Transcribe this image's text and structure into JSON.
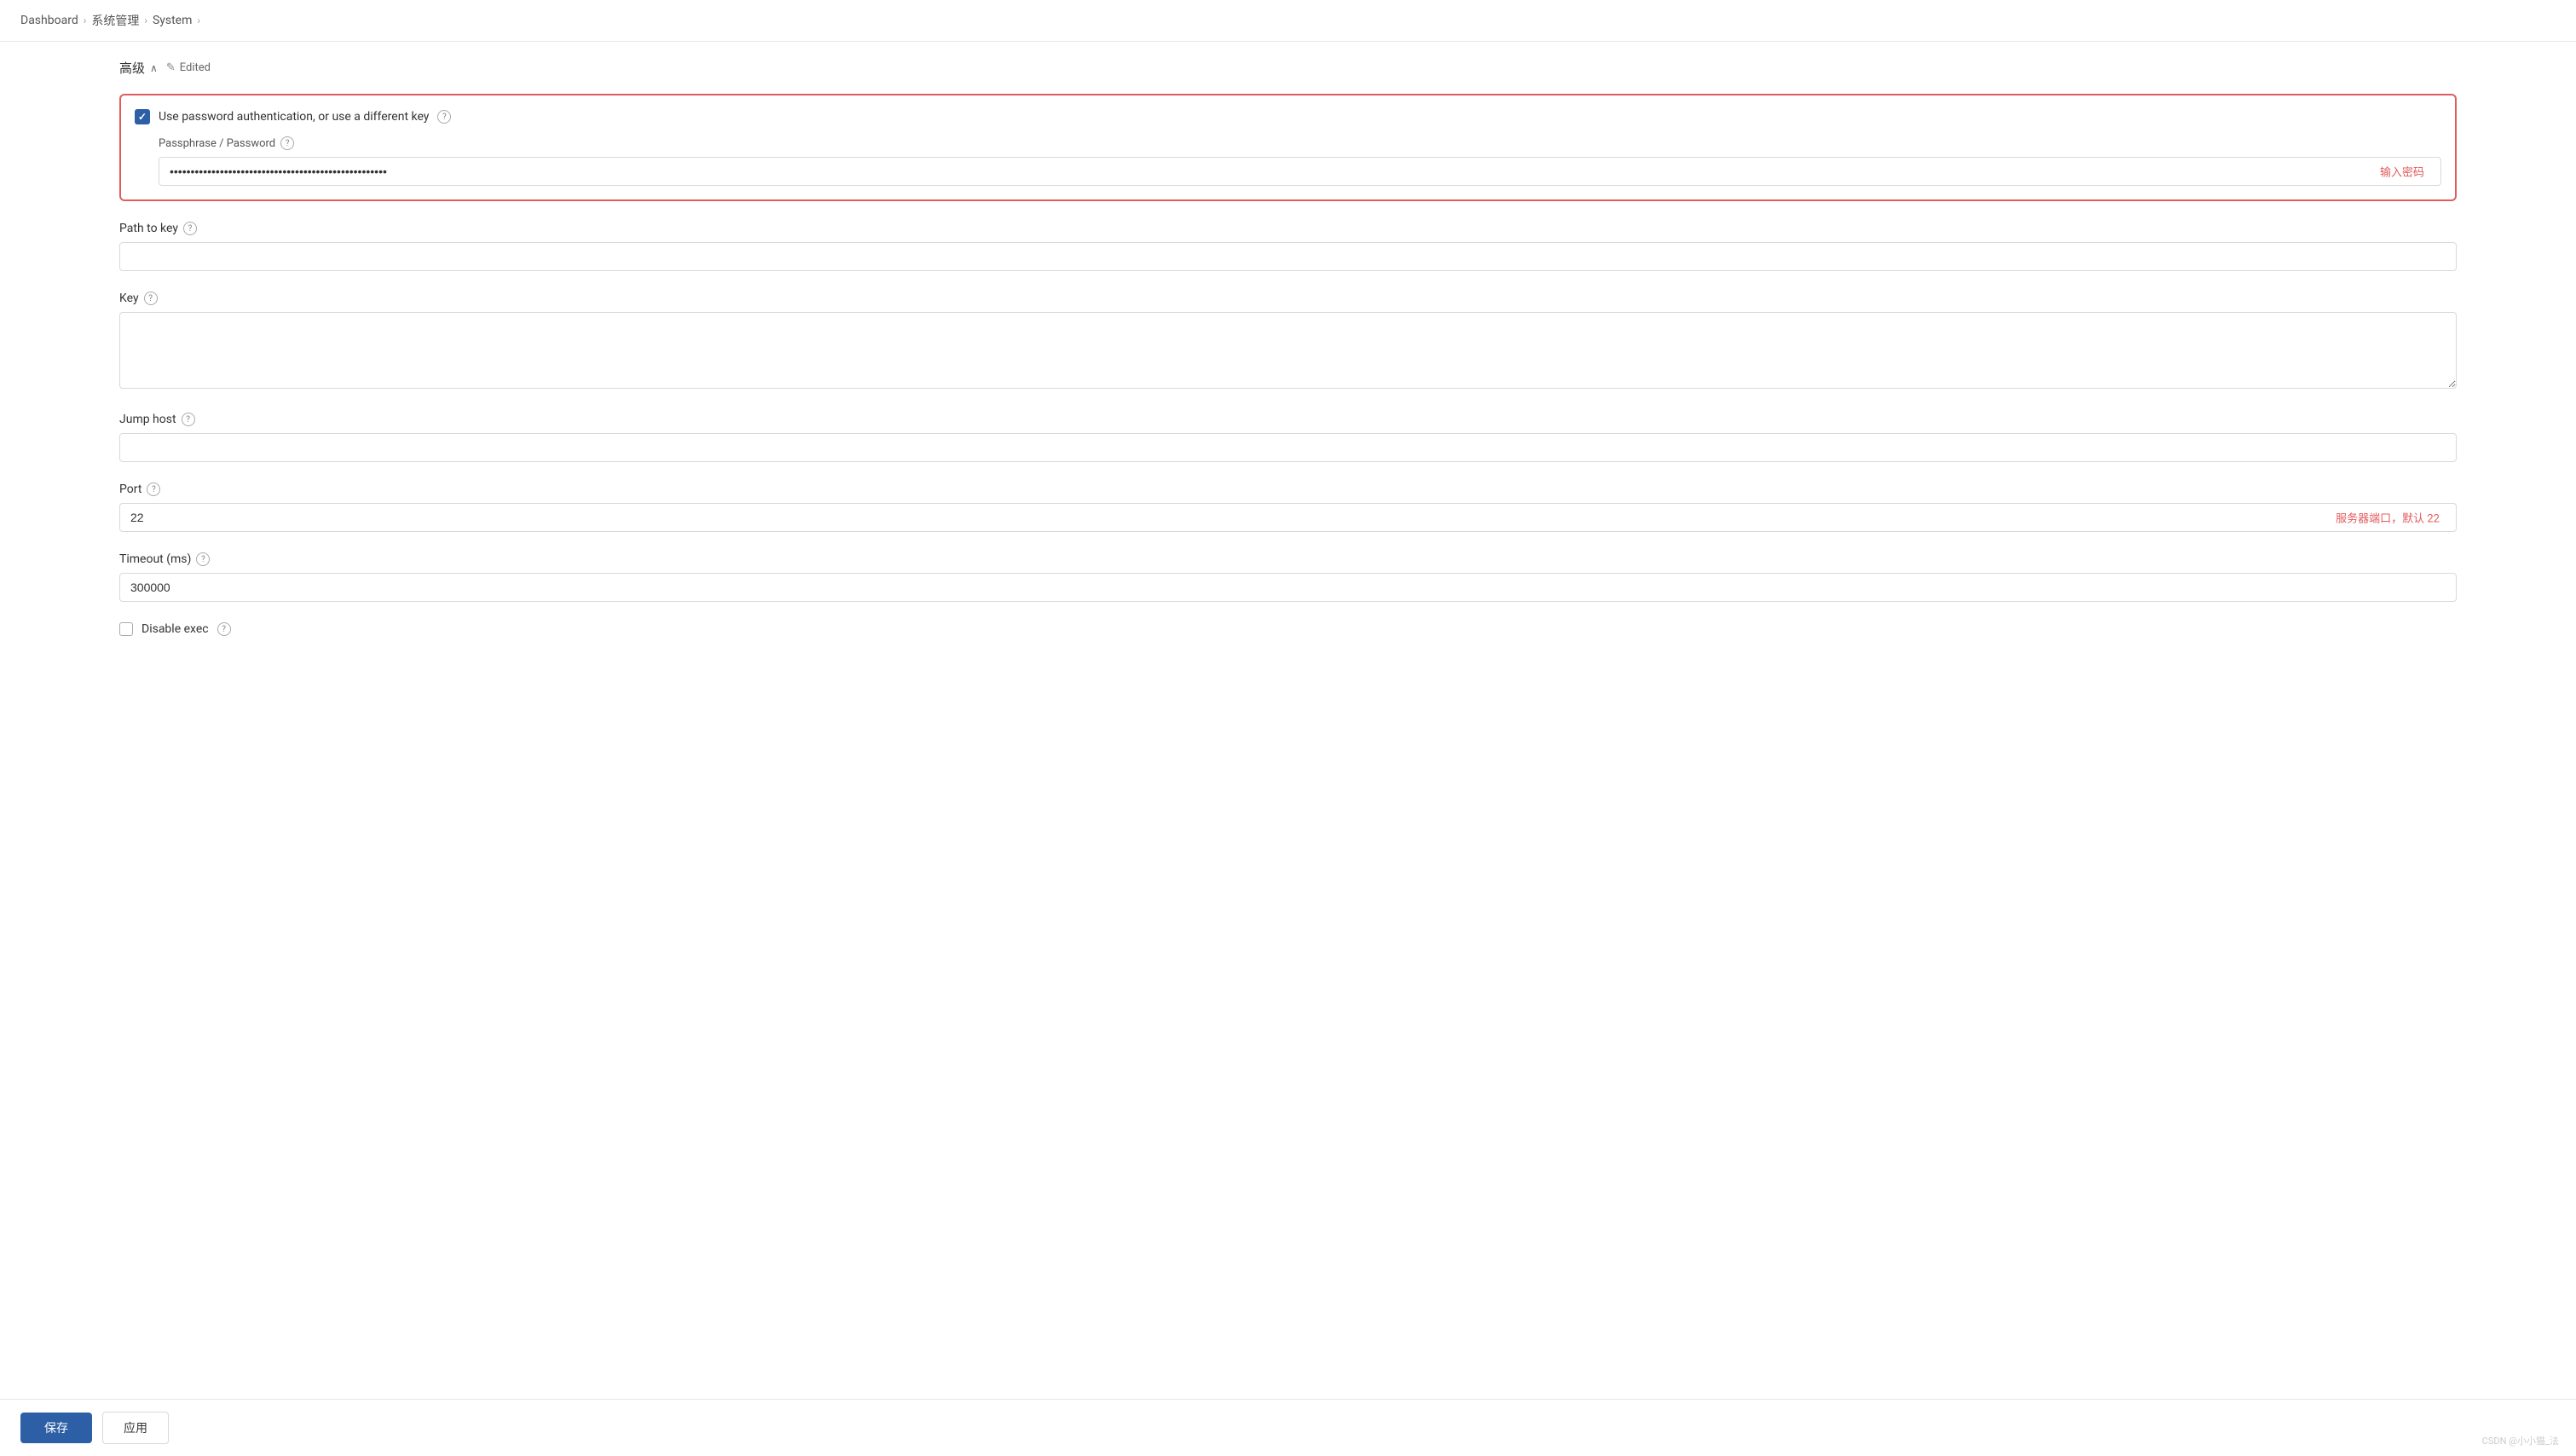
{
  "breadcrumb": {
    "items": [
      "Dashboard",
      "系统管理",
      "System"
    ],
    "separators": [
      "›",
      "›",
      "›"
    ]
  },
  "section": {
    "title": "高级",
    "chevron": "∧",
    "edited_icon": "✎",
    "edited_label": "Edited"
  },
  "password_auth": {
    "checkbox_label": "Use password authentication, or use a different key",
    "passphrase_label": "Passphrase / Password",
    "password_placeholder": "••••••••••••••••••••••••••••••••••••••••••••••••••••",
    "password_hint": "输入密码"
  },
  "fields": {
    "path_to_key": {
      "label": "Path to key",
      "value": "",
      "placeholder": ""
    },
    "key": {
      "label": "Key",
      "value": "",
      "placeholder": ""
    },
    "jump_host": {
      "label": "Jump host",
      "value": "",
      "placeholder": ""
    },
    "port": {
      "label": "Port",
      "value": "22",
      "hint": "服务器端口，默认 22"
    },
    "timeout": {
      "label": "Timeout (ms)",
      "value": "300000"
    },
    "disable_exec": {
      "label": "Disable exec"
    }
  },
  "help_icon_label": "?",
  "buttons": {
    "save": "保存",
    "apply": "应用"
  },
  "watermark": "CSDN @小小猫_法"
}
